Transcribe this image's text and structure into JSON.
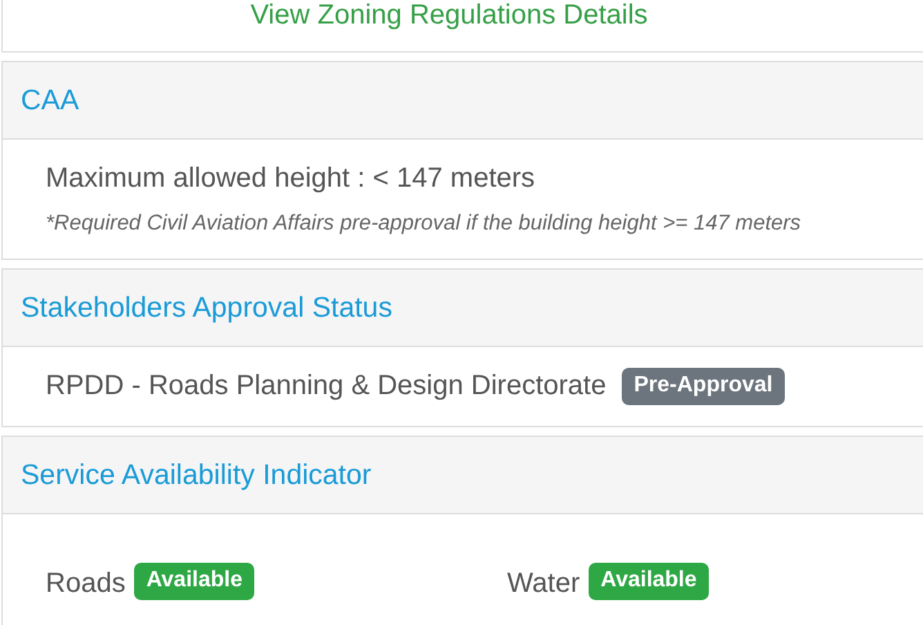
{
  "zoning": {
    "link": "View Zoning Regulations Details"
  },
  "caa": {
    "title": "CAA",
    "max_height": "Maximum allowed height : < 147 meters",
    "note": "*Required Civil Aviation Affairs pre-approval if the building height >= 147 meters"
  },
  "stakeholders": {
    "title": "Stakeholders Approval Status",
    "items": [
      {
        "name": "RPDD - Roads Planning & Design Directorate",
        "status": "Pre-Approval",
        "kind": "pending"
      }
    ]
  },
  "services": {
    "title": "Service Availability Indicator",
    "items": [
      {
        "name": "Roads",
        "status": "Available",
        "kind": "available"
      },
      {
        "name": "Water",
        "status": "Available",
        "kind": "available"
      }
    ]
  }
}
